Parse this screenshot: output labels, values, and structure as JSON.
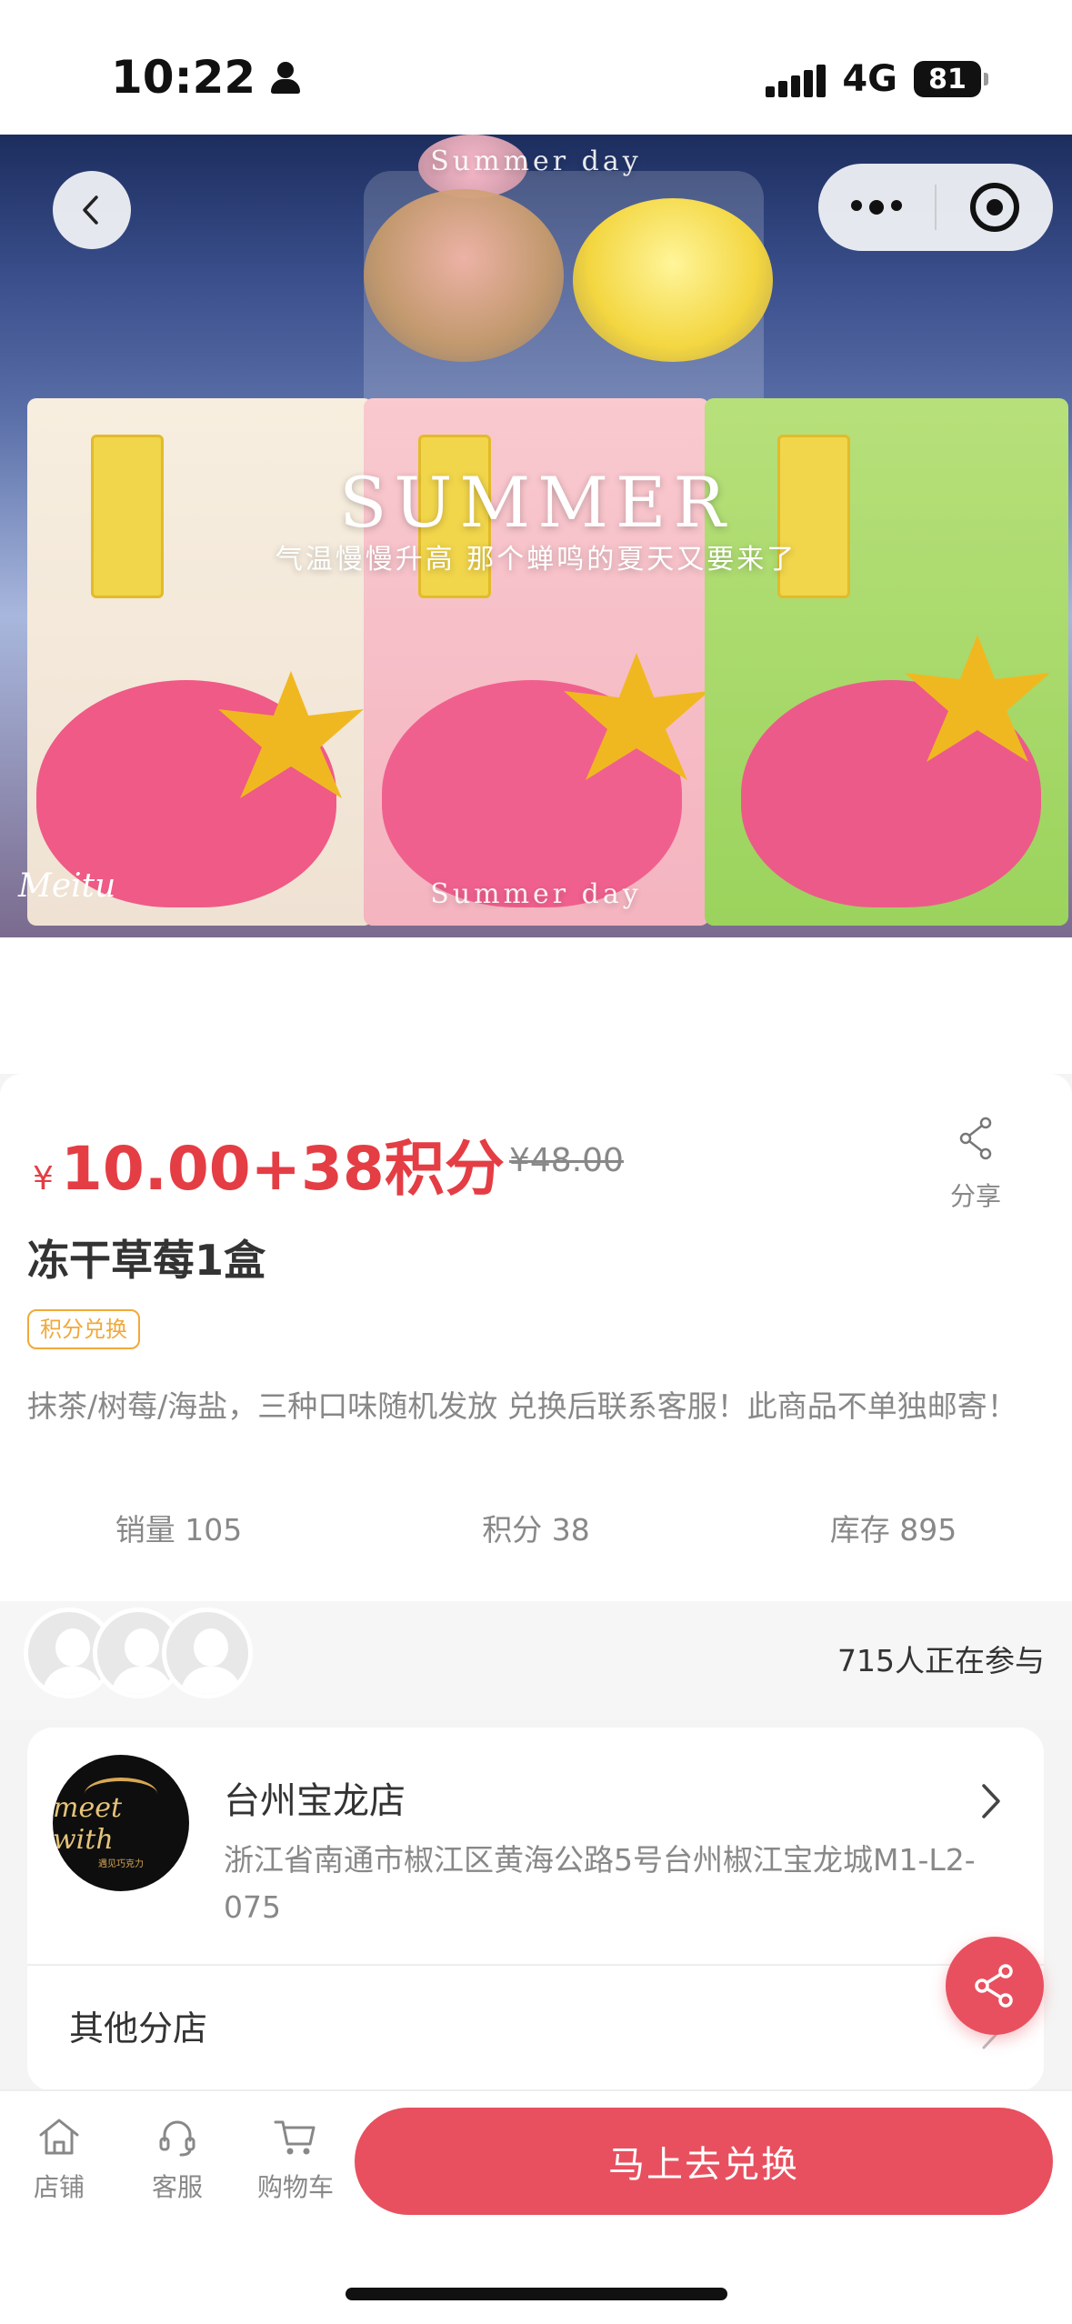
{
  "status_bar": {
    "time": "10:22",
    "network": "4G",
    "battery": "81"
  },
  "hero": {
    "watermark_top": "Summer day",
    "title_big": "SUMMER",
    "title_sub": "气温慢慢升高 那个蝉鸣的夏天又要来了",
    "watermark_bottom": "Summer day",
    "brand": "Meitu"
  },
  "product": {
    "price_symbol": "¥",
    "price": "10.00+38积分",
    "original_price": "¥48.00",
    "share_label": "分享",
    "title": "冻干草莓1盒",
    "tag": "积分兑换",
    "description": "抹茶/树莓/海盐，三种口味随机发放 兑换后联系客服！此商品不单独邮寄！",
    "stats": {
      "sales": "销量 105",
      "points": "积分 38",
      "stock": "库存 895"
    },
    "participating": "715人正在参与"
  },
  "store": {
    "logo_word": "meet with",
    "logo_cn": "遇见巧克力",
    "name": "台州宝龙店",
    "address": "浙江省南通市椒江区黄海公路5号台州椒江宝龙城M1-L2-075",
    "other_branches": "其他分店"
  },
  "bottom_bar": {
    "shop": "店铺",
    "service": "客服",
    "cart": "购物车",
    "cta": "马上去兑换"
  },
  "colors": {
    "accent": "#e43d44",
    "cta": "#e8505f",
    "tag": "#f0a93a"
  }
}
